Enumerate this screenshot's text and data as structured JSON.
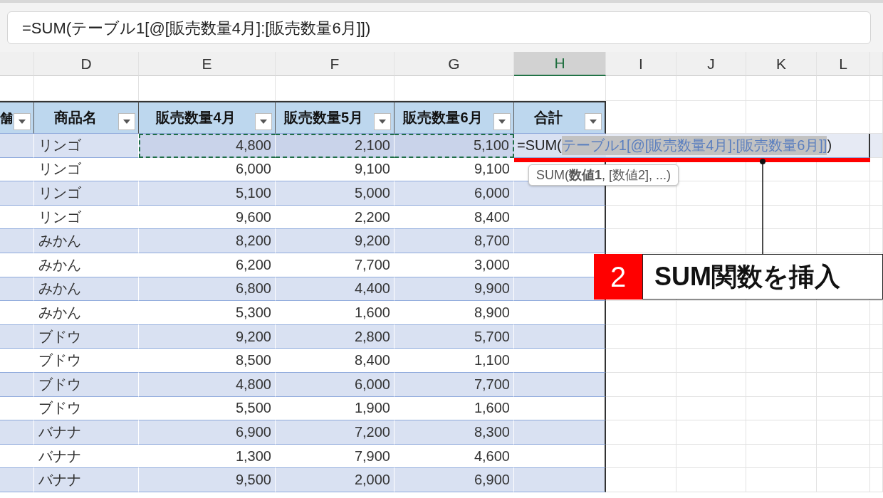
{
  "formula_bar": {
    "value": "=SUM(テーブル1[@[販売数量4月]:[販売数量6月]])"
  },
  "column_headers": [
    {
      "label": "D",
      "selected": false
    },
    {
      "label": "E",
      "selected": false
    },
    {
      "label": "F",
      "selected": false
    },
    {
      "label": "G",
      "selected": false
    },
    {
      "label": "H",
      "selected": true
    },
    {
      "label": "I",
      "selected": false
    },
    {
      "label": "J",
      "selected": false
    },
    {
      "label": "K",
      "selected": false
    },
    {
      "label": "L",
      "selected": false
    }
  ],
  "table": {
    "columns": [
      {
        "label": "舗"
      },
      {
        "label": "商品名"
      },
      {
        "label": "販売数量4月"
      },
      {
        "label": "販売数量5月"
      },
      {
        "label": "販売数量6月"
      },
      {
        "label": "合計"
      }
    ],
    "rows": [
      {
        "product": "リンゴ",
        "values": [
          "4,800",
          "2,100",
          "5,100"
        ],
        "referenced": true,
        "total": {
          "prefix": "=SUM(",
          "reference": "テーブル1[@[販売数量4月]:[販売数量6月]]",
          "suffix": ")"
        }
      },
      {
        "product": "リンゴ",
        "values": [
          "6,000",
          "9,100",
          "9,100"
        ],
        "referenced": false
      },
      {
        "product": "リンゴ",
        "values": [
          "5,100",
          "5,000",
          "6,000"
        ],
        "referenced": false
      },
      {
        "product": "リンゴ",
        "values": [
          "9,600",
          "2,200",
          "8,400"
        ],
        "referenced": false
      },
      {
        "product": "みかん",
        "values": [
          "8,200",
          "9,200",
          "8,700"
        ],
        "referenced": false
      },
      {
        "product": "みかん",
        "values": [
          "6,200",
          "7,700",
          "3,000"
        ],
        "referenced": false
      },
      {
        "product": "みかん",
        "values": [
          "6,800",
          "4,400",
          "9,900"
        ],
        "referenced": false
      },
      {
        "product": "みかん",
        "values": [
          "5,300",
          "1,600",
          "8,900"
        ],
        "referenced": false
      },
      {
        "product": "ブドウ",
        "values": [
          "9,200",
          "2,800",
          "5,700"
        ],
        "referenced": false
      },
      {
        "product": "ブドウ",
        "values": [
          "8,500",
          "8,400",
          "1,100"
        ],
        "referenced": false
      },
      {
        "product": "ブドウ",
        "values": [
          "4,800",
          "6,000",
          "7,700"
        ],
        "referenced": false
      },
      {
        "product": "ブドウ",
        "values": [
          "5,500",
          "1,900",
          "1,600"
        ],
        "referenced": false
      },
      {
        "product": "バナナ",
        "values": [
          "6,900",
          "7,200",
          "8,300"
        ],
        "referenced": false
      },
      {
        "product": "バナナ",
        "values": [
          "1,300",
          "7,900",
          "4,600"
        ],
        "referenced": false
      },
      {
        "product": "バナナ",
        "values": [
          "9,500",
          "2,000",
          "6,900"
        ],
        "referenced": false
      }
    ]
  },
  "function_tooltip": {
    "text": "SUM(**数値1**, [数値2], ...)"
  },
  "callout": {
    "number": "2",
    "label": "SUM関数を挿入"
  }
}
